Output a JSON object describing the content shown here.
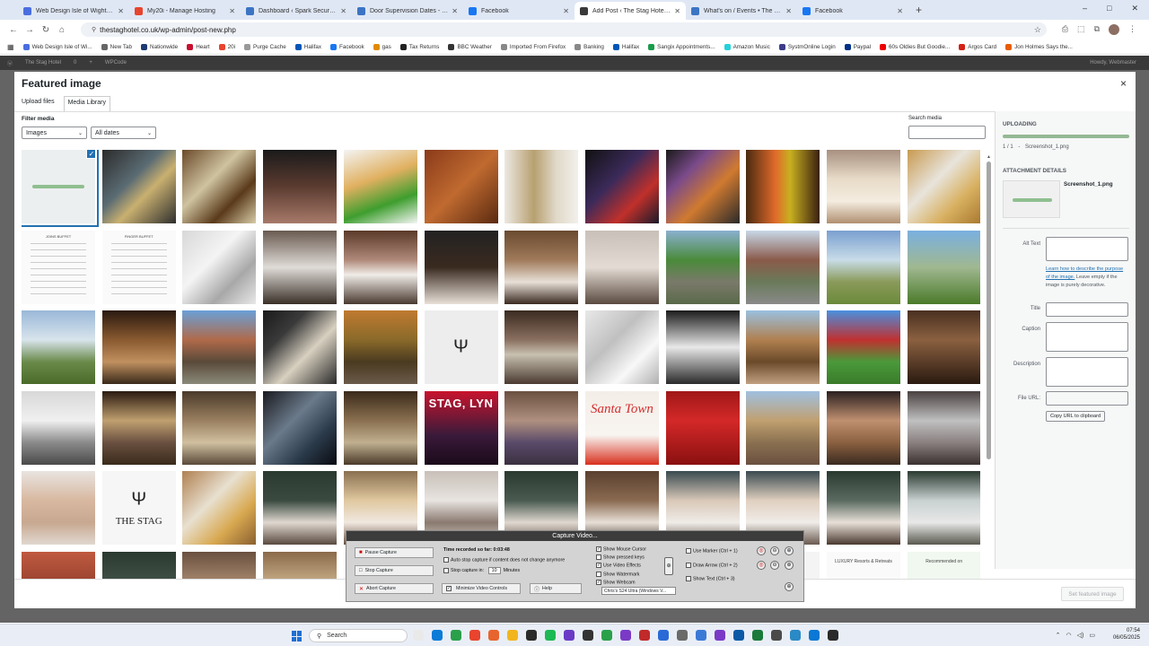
{
  "browser": {
    "tabs": [
      {
        "title": "Web Design Isle of Wight - Hosting",
        "color": "#4a6ee0"
      },
      {
        "title": "My20i - Manage Hosting",
        "color": "#e8442e"
      },
      {
        "title": "Dashboard ‹ Spark Security — Wo",
        "color": "#3c74c4"
      },
      {
        "title": "Door Supervision Dates - Spark Se",
        "color": "#3c74c4"
      },
      {
        "title": "Facebook",
        "color": "#1877f2"
      },
      {
        "title": "Add Post ‹ The Stag Hotel — Word",
        "color": "#3a3a3a",
        "active": true
      },
      {
        "title": "What's on / Events • The Stag Hot",
        "color": "#3c74c4"
      },
      {
        "title": "Facebook",
        "color": "#1877f2"
      }
    ],
    "new_tab": "+",
    "window_controls": [
      "–",
      "□",
      "✕"
    ],
    "url": "thestaghotel.co.uk/wp-admin/post-new.php",
    "bookmarks": [
      {
        "label": "Web Design Isle of Wi...",
        "color": "#4a6ee0"
      },
      {
        "label": "New Tab",
        "color": "#666"
      },
      {
        "label": "Nationwide",
        "color": "#1c3b73"
      },
      {
        "label": "Heart",
        "color": "#c8102e"
      },
      {
        "label": "20i",
        "color": "#e8442e"
      },
      {
        "label": "Purge Cache",
        "color": "#999"
      },
      {
        "label": "Halifax",
        "color": "#0057b8"
      },
      {
        "label": "Facebook",
        "color": "#1877f2"
      },
      {
        "label": "gas",
        "color": "#e08a00"
      },
      {
        "label": "Tax Returns",
        "color": "#222"
      },
      {
        "label": "BBC Weather",
        "color": "#333"
      },
      {
        "label": "Imported From Firefox",
        "color": "#888"
      },
      {
        "label": "Banking",
        "color": "#888"
      },
      {
        "label": "Halifax",
        "color": "#0057b8"
      },
      {
        "label": "Sangix Appointments...",
        "color": "#1a9c4a"
      },
      {
        "label": "Amazon Music",
        "color": "#25d1da"
      },
      {
        "label": "SystmOnline Login",
        "color": "#3c3c8a"
      },
      {
        "label": "Paypal",
        "color": "#003087"
      },
      {
        "label": "60s Oldies But Goodie...",
        "color": "#e00"
      },
      {
        "label": "Argos Card",
        "color": "#d42114"
      },
      {
        "label": "Jon Holmes Says the...",
        "color": "#e85d00"
      }
    ]
  },
  "admin_bar": {
    "items": [
      "The Stag Hotel",
      "0",
      "+",
      "WPCode"
    ],
    "howdy": "Howdy, Webmaster"
  },
  "modal": {
    "title": "Featured image",
    "close": "×",
    "tabs": [
      "Upload files",
      "Media Library"
    ],
    "filter_label": "Filter media",
    "filter_type": "Images",
    "filter_date": "All dates",
    "search_label": "Search media",
    "set_button": "Set featured image"
  },
  "media": [
    [
      {
        "kind": "upload",
        "bg": "#eceff0"
      },
      {
        "bg": "linear-gradient(135deg,#2b2b2b,#5a6b73 40%,#c9b070 60%,#2e2e2e)"
      },
      {
        "bg": "linear-gradient(135deg,#6b4a2a,#cfc3a0 40%,#5a3a1a 70%,#d8cca8)"
      },
      {
        "bg": "linear-gradient(180deg,#1a1a1a,#5b3b30 50%,#a77a6a)"
      },
      {
        "bg": "linear-gradient(160deg,#f4f4f4,#e0b060 40%,#3e9e2e 70%,#f5f5f5)"
      },
      {
        "bg": "linear-gradient(135deg,#8a3a1a,#c06a30 50%,#5a2a10)"
      },
      {
        "bg": "linear-gradient(90deg,#ece8e2,#b8a070 40%,#e0d8c8 70%,#f2f0ec)"
      },
      {
        "bg": "linear-gradient(135deg,#111,#3b2a5a 40%,#c0302a 70%,#1a1a2a)"
      },
      {
        "bg": "linear-gradient(135deg,#1a1a1a,#7a4a8a 30%,#d07a30 60%,#2a2a2a)"
      },
      {
        "bg": "linear-gradient(90deg,#4a2a10,#e06a2a 40%,#c8b020 60%,#3a2010)"
      },
      {
        "bg": "linear-gradient(180deg,#a89080,#e8dcc8 40%,#f4ece0 70%,#b09070)"
      },
      {
        "bg": "linear-gradient(135deg,#c89a50,#e8e4dc 40%,#d8b060 70%,#a87830)"
      }
    ],
    [
      {
        "kind": "menu",
        "text": "JOINS BUFFET",
        "bg": "#fafafa"
      },
      {
        "kind": "menu",
        "text": "FINGER BUFFET",
        "bg": "#fafafa"
      },
      {
        "bg": "linear-gradient(135deg,#d8d8d8,#f4f4f4 40%,#a8a8a8 70%,#e8e8e8)"
      },
      {
        "bg": "linear-gradient(180deg,#6a5a50,#e0dcd8 50%,#3a3028)"
      },
      {
        "bg": "linear-gradient(180deg,#5a3a2a,#b0897a 40%,#f0ece8 60%,#4a3a30)"
      },
      {
        "bg": "linear-gradient(180deg,#222,#3a2a20 50%,#e8e0d8)"
      },
      {
        "bg": "linear-gradient(180deg,#6a4a30,#a07a5a 40%,#e8e0d8 70%,#3a2a20)"
      },
      {
        "bg": "linear-gradient(180deg,#c8c0b8,#e4dcd4 50%,#5a4a40)"
      },
      {
        "bg": "linear-gradient(180deg,#8ab0d0,#4a8a3a 40%,#7a7a6a 70%,#5a6a4a)"
      },
      {
        "bg": "linear-gradient(180deg,#c8d8e8,#8a5a4a 40%,#6a7a5a 70%,#8a8a8a)"
      },
      {
        "bg": "linear-gradient(180deg,#7aa0d0,#c8dce8 40%,#8a9a5a 70%,#6a8a3a)"
      },
      {
        "bg": "linear-gradient(180deg,#7ab0e0,#a0b890 50%,#4a7a2a)"
      }
    ],
    [
      {
        "bg": "linear-gradient(180deg,#9ab8d8,#d8e4ec 40%,#6a8a4a 70%,#4a6a2a)"
      },
      {
        "bg": "linear-gradient(180deg,#2a1a10,#8a5a30 40%,#c09060 70%,#3a2a1a)"
      },
      {
        "bg": "linear-gradient(180deg,#6aa0d8,#b06a4a 40%,#5a4a3a 70%,#8a8a7a)"
      },
      {
        "bg": "linear-gradient(135deg,#1a1a1a,#3a3a3a 30%,#d8d0c0 60%,#2a2a2a)"
      },
      {
        "bg": "linear-gradient(180deg,#c07a30,#8a6a2a 40%,#4a3a20 70%,#6a5a4a)"
      },
      {
        "kind": "logo",
        "bg": "#ededed"
      },
      {
        "bg": "linear-gradient(180deg,#3a2a20,#8a7060 40%,#c8c0b0 60%,#4a3a30)"
      },
      {
        "bg": "linear-gradient(135deg,#e8e8e8,#c0c0c0 40%,#f8f8f8 70%,#b0b0b0)"
      },
      {
        "bg": "linear-gradient(180deg,#1a1a1a,#e8e8e8 50%,#2a2a2a)"
      },
      {
        "bg": "linear-gradient(180deg,#9ac0e0,#b08050 40%,#6a4a2a 70%,#c0a080)"
      },
      {
        "bg": "linear-gradient(180deg,#4a90e0,#c03030 40%,#4a9a3a 70%,#3a7a2a)"
      },
      {
        "bg": "linear-gradient(180deg,#4a3020,#8a6040 40%,#2a1a10)"
      }
    ],
    [
      {
        "bg": "linear-gradient(180deg,#d8d8d8,#f0f0f0 40%,#8a8a8a 70%,#4a4a4a)"
      },
      {
        "bg": "linear-gradient(180deg,#2a1a10,#c0a070 40%,#6a5040 70%,#3a2a1a)"
      },
      {
        "bg": "linear-gradient(180deg,#4a3a2a,#9a8060 40%,#d0c0a0 70%,#5a4a3a)"
      },
      {
        "bg": "linear-gradient(135deg,#1a1a20,#6a7a8a 40%,#2a3a4a 70%,#0a0a10)"
      },
      {
        "bg": "linear-gradient(180deg,#3a2a1a,#8a7050 40%,#c0b090 70%,#4a3a2a)"
      },
      {
        "kind": "stag",
        "text": "STAG, LYN",
        "bg": "linear-gradient(180deg,#c8142e,#3a1a3a 60%,#1a0a1a)"
      },
      {
        "bg": "linear-gradient(180deg,#6a5040,#b09080 40%,#5a4a6a 70%,#3a3040)"
      },
      {
        "kind": "santa",
        "text": "Santa Town",
        "bg": "linear-gradient(180deg,#f4eee8,#f8f4f0 60%,#d8301e)"
      },
      {
        "bg": "linear-gradient(180deg,#a01818,#d42828 40%,#8a1010)"
      },
      {
        "bg": "linear-gradient(180deg,#a0c0e0,#c0a070 40%,#8a7050 70%,#6a5040)"
      },
      {
        "bg": "linear-gradient(180deg,#2a2020,#c09070 40%,#8a6040 70%,#3a2a20)"
      },
      {
        "bg": "linear-gradient(180deg,#4a4040,#c0c0c0 40%,#8a8080 70%,#3a3030)"
      }
    ],
    [
      {
        "bg": "linear-gradient(180deg,#e8e4e0,#d8b8a0 40%,#c8a890 70%,#e0d8d0)"
      },
      {
        "kind": "logo",
        "text": "THE STAG",
        "bg": "#f6f6f6"
      },
      {
        "bg": "linear-gradient(135deg,#b08050,#e8e0d0 40%,#d8a850 70%,#8a6030)"
      },
      {
        "bg": "linear-gradient(180deg,#2a3a30,#3a4a40 40%,#e0d8d0 70%,#5a4a40)"
      },
      {
        "bg": "linear-gradient(180deg,#8a7050,#e0c8a0 40%,#f0e8e0 70%,#6a5040)"
      },
      {
        "bg": "linear-gradient(180deg,#c8c0b8,#e8e4e0 40%,#8a7a70 70%,#d8d0c8)"
      },
      {
        "bg": "linear-gradient(180deg,#2a3a30,#4a5a50 40%,#e0d8d0 70%,#5a4a40)"
      },
      {
        "bg": "linear-gradient(180deg,#5a4030,#8a6a50 40%,#e8e0d8 70%,#3a2a20)"
      },
      {
        "bg": "linear-gradient(180deg,#3a4a50,#d8c8b8 40%,#f0ece8 70%,#6a5a50)"
      },
      {
        "bg": "linear-gradient(180deg,#3a4a50,#e0d0c0 40%,#f0ece8 70%,#6a5a50)"
      },
      {
        "bg": "linear-gradient(180deg,#2a3a30,#5a6a60 40%,#e8e0d8 70%,#4a3a30)"
      },
      {
        "bg": "linear-gradient(180deg,#2a3a30,#c8d0d0 40%,#e8e8e8 70%,#5a5a50)"
      }
    ],
    [
      {
        "bg": "linear-gradient(180deg,#c05a40,#8a3a2a 60%)"
      },
      {
        "bg": "linear-gradient(180deg,#2a3a30,#4a5a50 60%)"
      },
      {
        "bg": "linear-gradient(180deg,#6a5040,#c0a080 60%)"
      },
      {
        "bg": "linear-gradient(180deg,#8a6a4a,#e0c8a0 60%)"
      },
      {
        "bg": "#f4f4f4"
      },
      {
        "bg": "#f4f4f4"
      },
      {
        "bg": "#f4f4f4"
      },
      {
        "bg": "#f4f4f4"
      },
      {
        "bg": "#f4f4f4"
      },
      {
        "bg": "#f4f4f4"
      },
      {
        "kind": "award",
        "text": "LUXURY Resorts & Retreats",
        "bg": "#fafafa"
      },
      {
        "kind": "award",
        "text": "Recommended on",
        "bg": "#f0f8f0"
      }
    ]
  ],
  "attachment": {
    "uploading_label": "UPLOADING",
    "file_count": "1 / 1",
    "file_name": "Screenshot_1.png",
    "details_label": "ATTACHMENT DETAILS",
    "thumb_name": "Screenshot_1.png",
    "alt_label": "Alt Text",
    "help_link": "Learn how to describe the purpose of the image.",
    "help_text": "Leave empty if the image is purely decorative.",
    "title_label": "Title",
    "caption_label": "Caption",
    "description_label": "Description",
    "fileurl_label": "File URL:",
    "copy_button": "Copy URL to clipboard"
  },
  "capture": {
    "title": "Capture Video...",
    "pause": "Pause Capture",
    "stop": "Stop Capture",
    "abort": "Abort Capture",
    "time_label": "Time recorded so far: 0:03:48",
    "auto_stop": "Auto stop capture if content does not change anymore",
    "stop_in_prefix": "Stop capture in:",
    "stop_in_value": "10",
    "stop_in_suffix": "Minutes",
    "minimize": "Minimize Video Controls",
    "help": "Help",
    "options": [
      "Show Mouse Cursor",
      "Show pressed keys",
      "Use Video Effects",
      "Show Watermark",
      "Show Webcam"
    ],
    "webcam_device": "Chris's S24 Ultra (Windows V...",
    "use_marker": "Use Marker (Ctrl + 1)",
    "draw_arrow": "Draw Arrow (Ctrl + 2)",
    "show_text": "Show Text (Ctrl + 3)"
  },
  "taskbar": {
    "search": "Search",
    "time": "07:54",
    "date": "06/05/2025",
    "apps": [
      "#e9e9e9",
      "#0a7bd6",
      "#2aa04a",
      "#e8442e",
      "#e8642e",
      "#f2b51e",
      "#2a2a2a",
      "#1db954",
      "#6a3ac6",
      "#333",
      "#2aa04a",
      "#7a3ac6",
      "#c02a2a",
      "#2a6ad6",
      "#6a6a6a",
      "#3a7ad6",
      "#7a3ac6",
      "#0a5aa6",
      "#1a7a3a",
      "#4a4a4a",
      "#2a8ac6",
      "#0a78d4",
      "#2a2a2a"
    ]
  }
}
